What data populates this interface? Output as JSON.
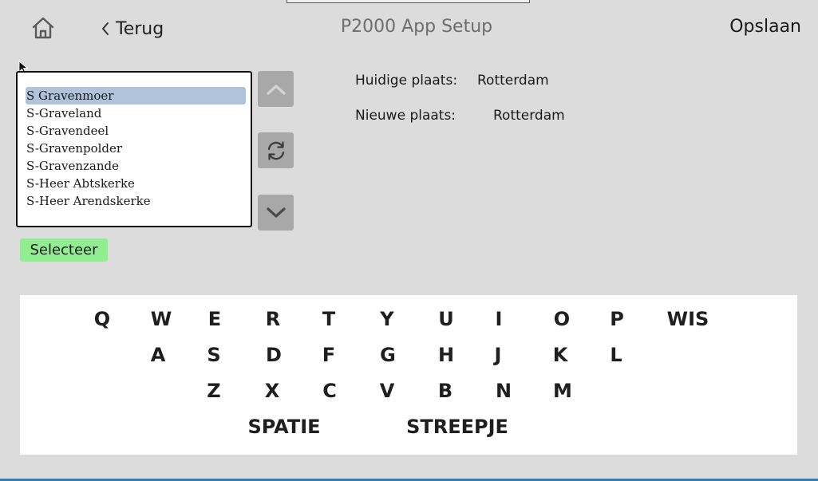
{
  "header": {
    "title": "P2000 App Setup",
    "back_label": "Terug",
    "save_label": "Opslaan"
  },
  "places": {
    "items": [
      "S Gravenmoer",
      "S-Graveland",
      "S-Gravendeel",
      "S-Gravenpolder",
      "S-Gravenzande",
      "S-Heer Abtskerke",
      "S-Heer Arendskerke"
    ],
    "selected_index": 0
  },
  "select_label": "Selecteer",
  "info": {
    "current_label": "Huidige plaats:",
    "current_value": "Rotterdam",
    "new_label": "Nieuwe plaats:",
    "new_value": "Rotterdam"
  },
  "keyboard": {
    "row1": [
      "Q",
      "W",
      "E",
      "R",
      "T",
      "Y",
      "U",
      "I",
      "O",
      "P",
      "WIS"
    ],
    "row2": [
      "A",
      "S",
      "D",
      "F",
      "G",
      "H",
      "J",
      "K",
      "L"
    ],
    "row3": [
      "Z",
      "X",
      "C",
      "V",
      "B",
      "N",
      "M"
    ],
    "row4": [
      "SPATIE",
      "STREEPJE"
    ]
  },
  "icons": {
    "home": "home-icon",
    "back": "chevron-left-icon",
    "up": "chevron-up-icon",
    "refresh": "refresh-icon",
    "down": "chevron-down-icon"
  },
  "colors": {
    "background": "#dcdcdc",
    "select_button": "#90ee90",
    "list_selection": "#b1c3db",
    "side_button": "#a8a8a8",
    "keyboard_bg": "#ffffff"
  }
}
